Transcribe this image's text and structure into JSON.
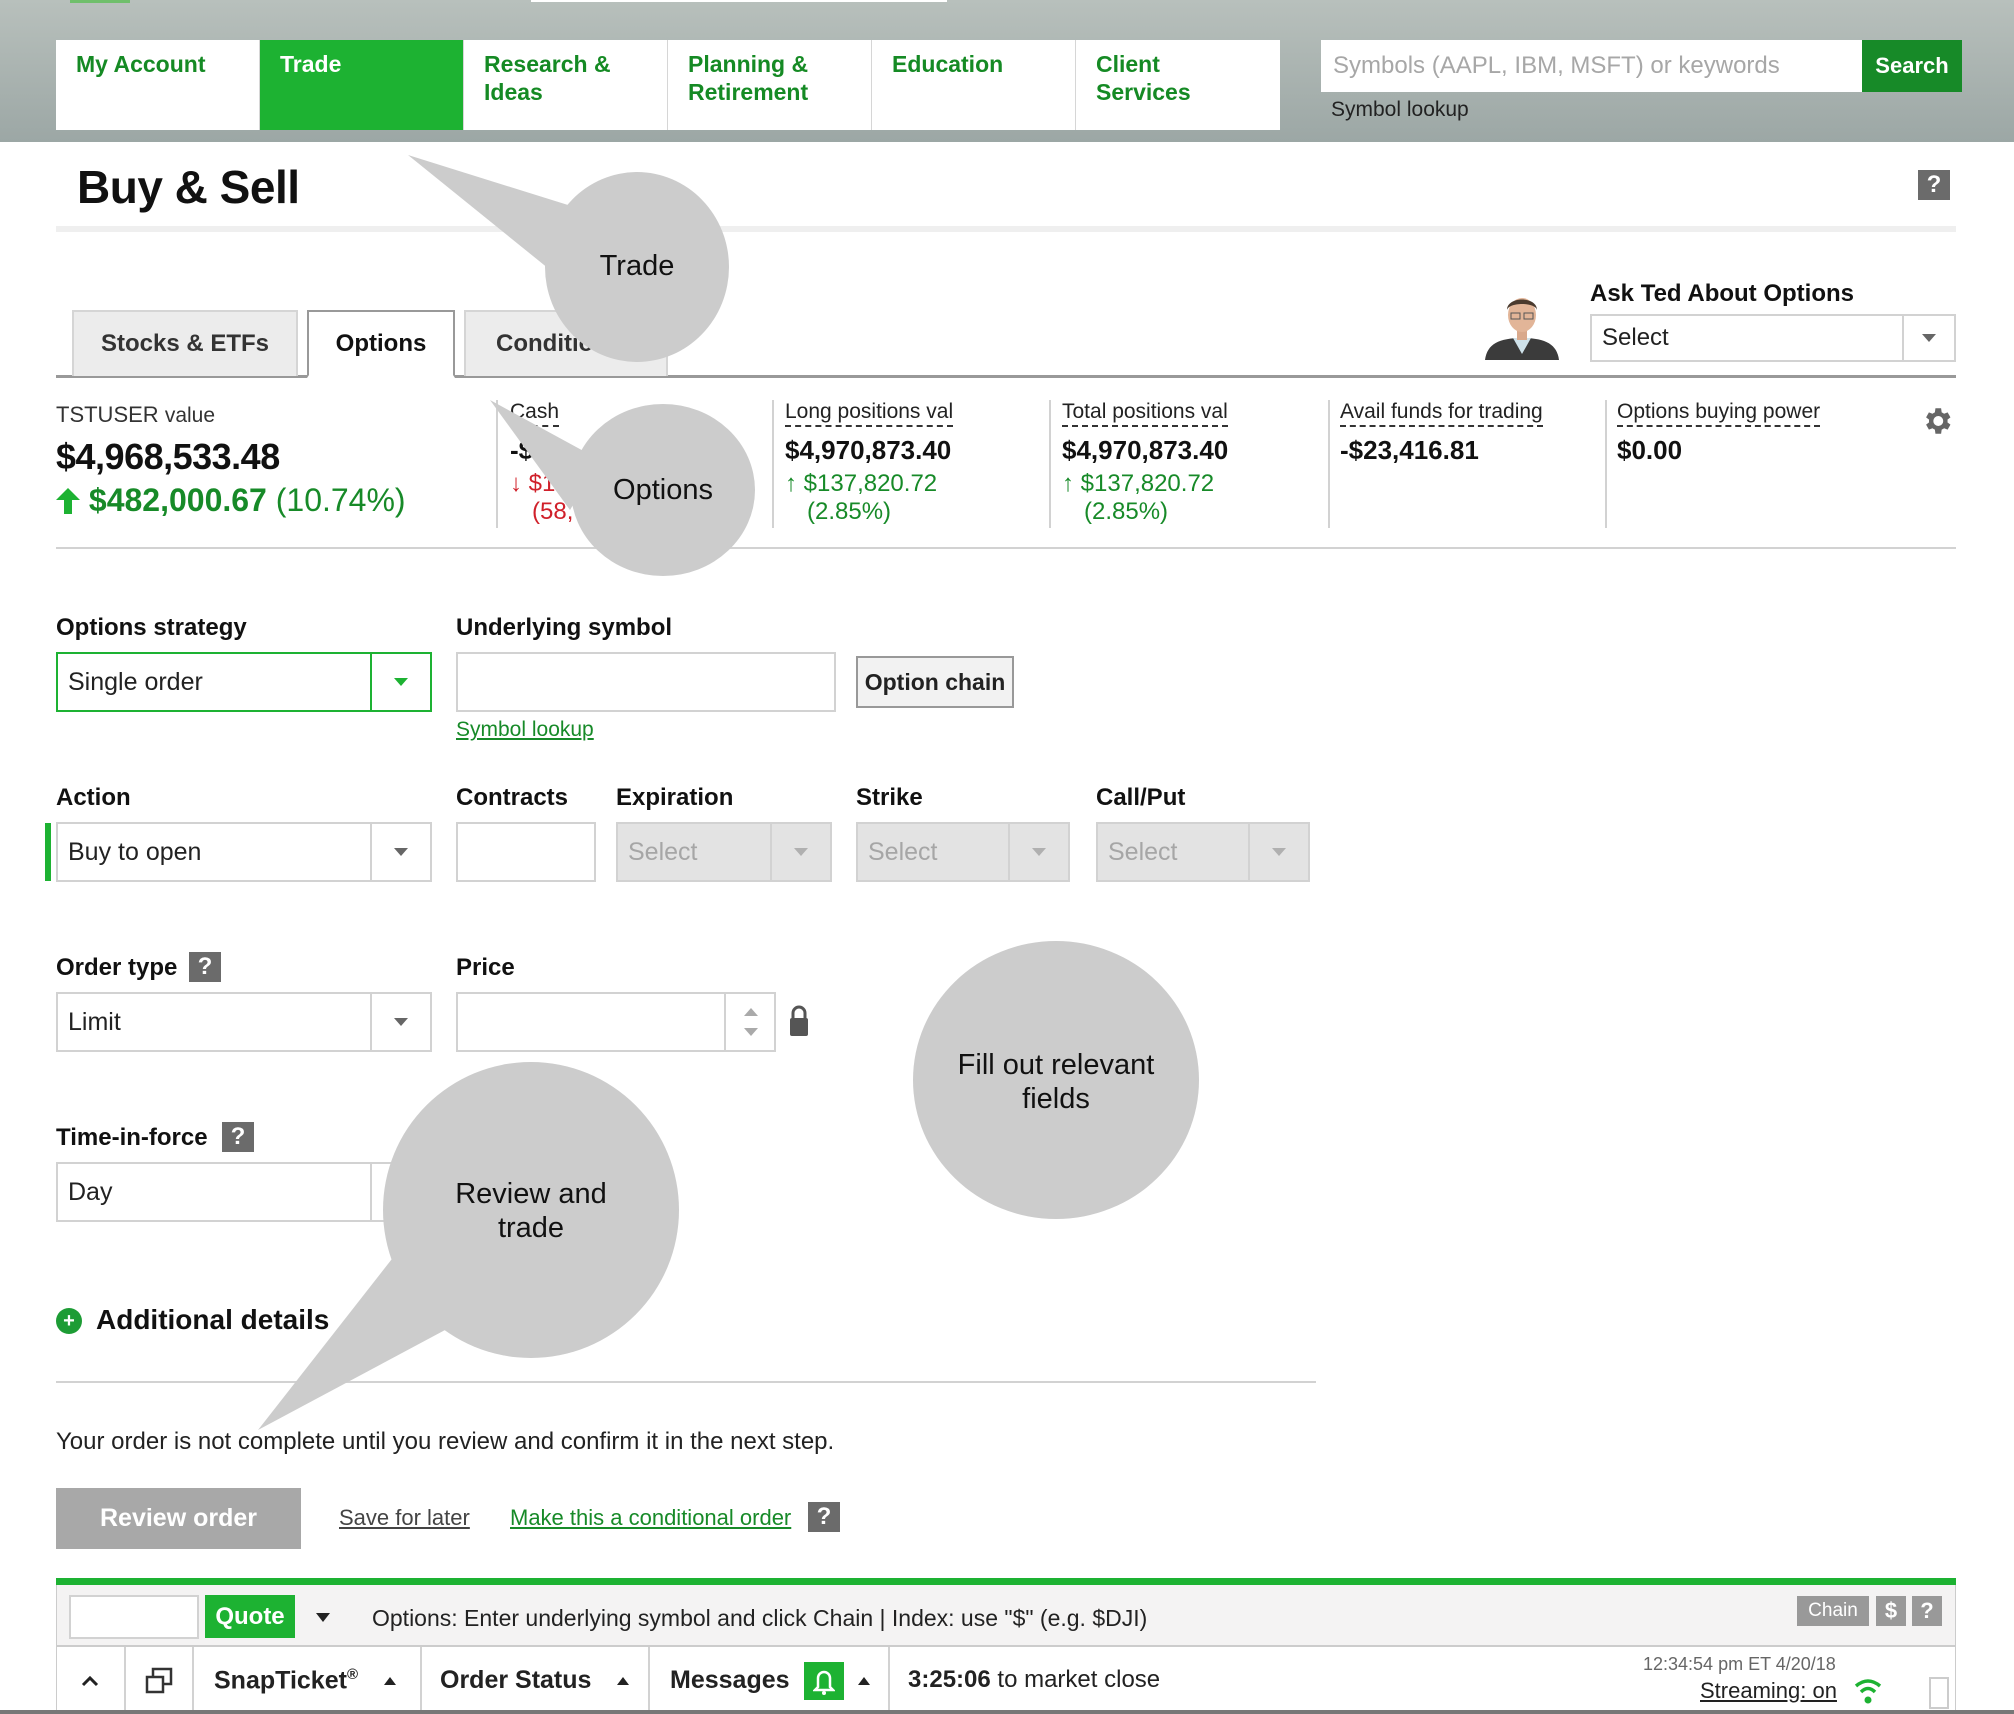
{
  "header": {
    "nav": [
      {
        "label": "My Account",
        "active": false
      },
      {
        "label": "Trade",
        "active": true
      },
      {
        "label": "Research & Ideas",
        "active": false
      },
      {
        "label": "Planning & Retirement",
        "active": false
      },
      {
        "label": "Education",
        "active": false
      },
      {
        "label": "Client Services",
        "active": false
      }
    ],
    "search_placeholder": "Symbols (AAPL, IBM, MSFT) or keywords",
    "search_value": "",
    "search_button": "Search",
    "symbol_lookup": "Symbol lookup"
  },
  "page": {
    "title": "Buy & Sell",
    "help_label": "?"
  },
  "tabs": [
    {
      "label": "Stocks & ETFs",
      "active": false
    },
    {
      "label": "Options",
      "active": true
    },
    {
      "label": "Conditional",
      "active": false
    }
  ],
  "ask_ted": {
    "label": "Ask Ted About Options",
    "selected": "Select"
  },
  "balances": {
    "account_name": "TSTUSER",
    "account_suffix": "value",
    "account_value": "$4,968,533.48",
    "account_change": "$482,000.67",
    "account_change_pct": "(10.74%)",
    "items": [
      {
        "label": "Cash",
        "value": "-$12",
        "change": "$12",
        "change_pct": "(58,",
        "direction": "down"
      },
      {
        "label": "Long positions val",
        "value": "$4,970,873.40",
        "change": "$137,820.72",
        "change_pct": "(2.85%)",
        "direction": "up"
      },
      {
        "label": "Total positions val",
        "value": "$4,970,873.40",
        "change": "$137,820.72",
        "change_pct": "(2.85%)",
        "direction": "up"
      },
      {
        "label": "Avail funds for trading",
        "value": "-$23,416.81"
      },
      {
        "label": "Options buying power",
        "value": "$0.00"
      }
    ]
  },
  "form": {
    "strategy": {
      "label": "Options strategy",
      "value": "Single order"
    },
    "underlying": {
      "label": "Underlying symbol",
      "value": "",
      "lookup_link": "Symbol lookup",
      "chain_button": "Option chain"
    },
    "action": {
      "label": "Action",
      "value": "Buy to open"
    },
    "contracts": {
      "label": "Contracts",
      "value": ""
    },
    "expiration": {
      "label": "Expiration",
      "value": "Select"
    },
    "strike": {
      "label": "Strike",
      "value": "Select"
    },
    "call_put": {
      "label": "Call/Put",
      "value": "Select"
    },
    "order_type": {
      "label": "Order type",
      "value": "Limit"
    },
    "price": {
      "label": "Price",
      "value": ""
    },
    "time_in_force": {
      "label": "Time-in-force",
      "value": "Day"
    },
    "additional_details": "Additional details",
    "notice": "Your order is not complete until you review and confirm it in the next step.",
    "review_button": "Review order",
    "save_later": "Save for later",
    "conditional_link": "Make this a conditional order"
  },
  "snapbar": {
    "symbol_value": "",
    "quote_button": "Quote",
    "hint": "Options: Enter underlying symbol and click Chain | Index: use \"$\" (e.g. $DJI)",
    "chain_button": "Chain",
    "dollar_button": "$",
    "help_button": "?",
    "snapticket_label": "SnapTicket",
    "snapticket_mark": "®",
    "order_status_label": "Order Status",
    "messages_label": "Messages",
    "countdown": "3:25:06",
    "countdown_suffix": "to market close",
    "timestamp": "12:34:54 pm ET 4/20/18",
    "streaming": "Streaming: on"
  },
  "callouts": [
    {
      "text": "Trade"
    },
    {
      "text": "Options"
    },
    {
      "text": "Fill out relevant fields"
    },
    {
      "text": "Review and trade"
    }
  ],
  "colors": {
    "brand_green": "#1db232",
    "dark_green": "#178a28",
    "negative_red": "#d0202a"
  }
}
